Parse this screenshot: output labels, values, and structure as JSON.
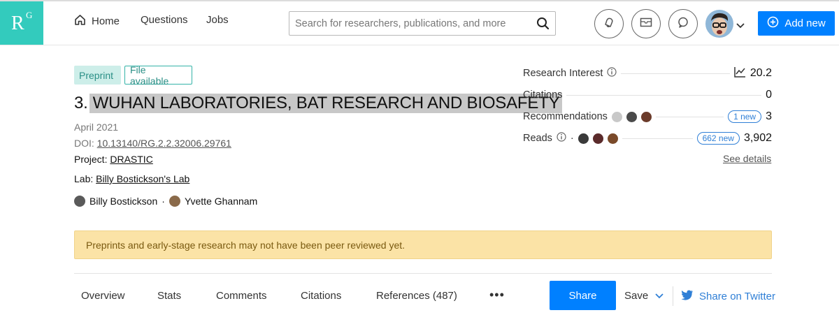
{
  "nav": {
    "logo_r": "R",
    "logo_g": "G",
    "home": "Home",
    "questions": "Questions",
    "jobs": "Jobs",
    "search_placeholder": "Search for researchers, publications, and more",
    "add_new": "Add new"
  },
  "publication": {
    "tag_preprint": "Preprint",
    "tag_file": "File available",
    "title_prefix": "3.",
    "title_main": "WUHAN LABORATORIES, BAT RESEARCH AND BIOSAFETY",
    "date": "April 2021",
    "doi_label": "DOI:",
    "doi_value": "10.13140/RG.2.2.32006.29761",
    "project_label": "Project:",
    "project_value": "DRASTIC",
    "lab_label": "Lab:",
    "lab_value": "Billy Bostickson's Lab",
    "author1": "Billy Bostickson",
    "author_sep": "·",
    "author2": "Yvette Ghannam"
  },
  "stats": {
    "research_interest_label": "Research Interest",
    "research_interest_value": "20.2",
    "citations_label": "Citations",
    "citations_value": "0",
    "recommendations_label": "Recommendations",
    "recommendations_new": "1 new",
    "recommendations_value": "3",
    "reads_label": "Reads",
    "reads_sep": "·",
    "reads_new": "662 new",
    "reads_value": "3,902",
    "see_details": "See details"
  },
  "warning": "Preprints and early-stage research may not have been peer reviewed yet.",
  "tabs": {
    "overview": "Overview",
    "stats": "Stats",
    "comments": "Comments",
    "citations": "Citations",
    "references": "References (487)",
    "more": "•••",
    "share": "Share",
    "save": "Save",
    "share_twitter": "Share on Twitter"
  },
  "colors": {
    "brand_teal": "#33cbbd",
    "primary_blue": "#0080ff",
    "warning_bg": "#fbe3a6",
    "link_blue": "#2f7fd6"
  }
}
